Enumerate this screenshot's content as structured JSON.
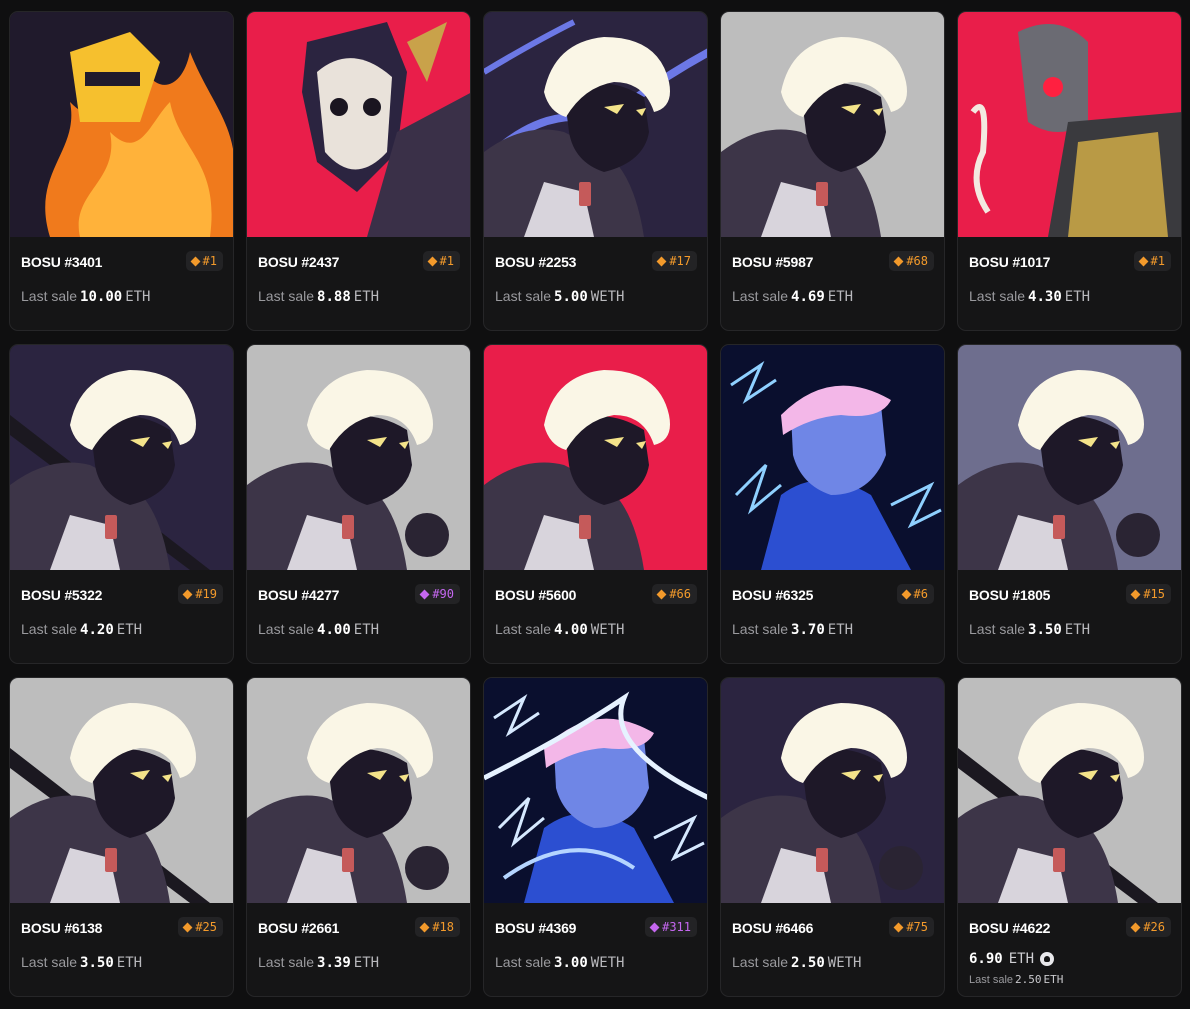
{
  "sale_label": "Last sale",
  "cards": [
    {
      "name": "BOSU #3401",
      "rank": "#1",
      "rarity": "orange",
      "price": "10.00",
      "currency": "ETH",
      "bg": "#201a2c",
      "variant": "fire"
    },
    {
      "name": "BOSU #2437",
      "rank": "#1",
      "rarity": "orange",
      "price": "8.88",
      "currency": "ETH",
      "bg": "#e91e4a",
      "variant": "skull"
    },
    {
      "name": "BOSU #2253",
      "rank": "#17",
      "rarity": "orange",
      "price": "5.00",
      "currency": "WETH",
      "bg": "#2b2440",
      "variant": "lightning-purple"
    },
    {
      "name": "BOSU #5987",
      "rank": "#68",
      "rarity": "orange",
      "price": "4.69",
      "currency": "ETH",
      "bg": "#bdbdbd",
      "variant": "hero"
    },
    {
      "name": "BOSU #1017",
      "rank": "#1",
      "rarity": "orange",
      "price": "4.30",
      "currency": "ETH",
      "bg": "#e91e4a",
      "variant": "robot"
    },
    {
      "name": "BOSU #5322",
      "rank": "#19",
      "rarity": "orange",
      "price": "4.20",
      "currency": "ETH",
      "bg": "#2b2440",
      "variant": "hero-sword"
    },
    {
      "name": "BOSU #4277",
      "rank": "#90",
      "rarity": "epic",
      "price": "4.00",
      "currency": "ETH",
      "bg": "#bdbdbd",
      "variant": "hero-fist"
    },
    {
      "name": "BOSU #5600",
      "rank": "#66",
      "rarity": "orange",
      "price": "4.00",
      "currency": "WETH",
      "bg": "#e91e4a",
      "variant": "hero"
    },
    {
      "name": "BOSU #6325",
      "rank": "#6",
      "rarity": "orange",
      "price": "3.70",
      "currency": "ETH",
      "bg": "#0a0f2e",
      "variant": "blue-boy"
    },
    {
      "name": "BOSU #1805",
      "rank": "#15",
      "rarity": "orange",
      "price": "3.50",
      "currency": "ETH",
      "bg": "#6e6e8e",
      "variant": "hero-fist"
    },
    {
      "name": "BOSU #6138",
      "rank": "#25",
      "rarity": "orange",
      "price": "3.50",
      "currency": "ETH",
      "bg": "#bdbdbd",
      "variant": "hero-sword"
    },
    {
      "name": "BOSU #2661",
      "rank": "#18",
      "rarity": "orange",
      "price": "3.39",
      "currency": "ETH",
      "bg": "#bdbdbd",
      "variant": "hero-fist"
    },
    {
      "name": "BOSU #4369",
      "rank": "#311",
      "rarity": "epic",
      "price": "3.00",
      "currency": "WETH",
      "bg": "#0a0f2e",
      "variant": "blue-lightning"
    },
    {
      "name": "BOSU #6466",
      "rank": "#75",
      "rarity": "orange",
      "price": "2.50",
      "currency": "WETH",
      "bg": "#2b2440",
      "variant": "hero-fist"
    },
    {
      "name": "BOSU #4622",
      "rank": "#26",
      "rarity": "orange",
      "price": "2.50",
      "currency": "ETH",
      "bg": "#bdbdbd",
      "variant": "hero-sword",
      "listing": {
        "price": "6.90",
        "currency": "ETH",
        "icon": "marketplace-icon"
      }
    }
  ]
}
